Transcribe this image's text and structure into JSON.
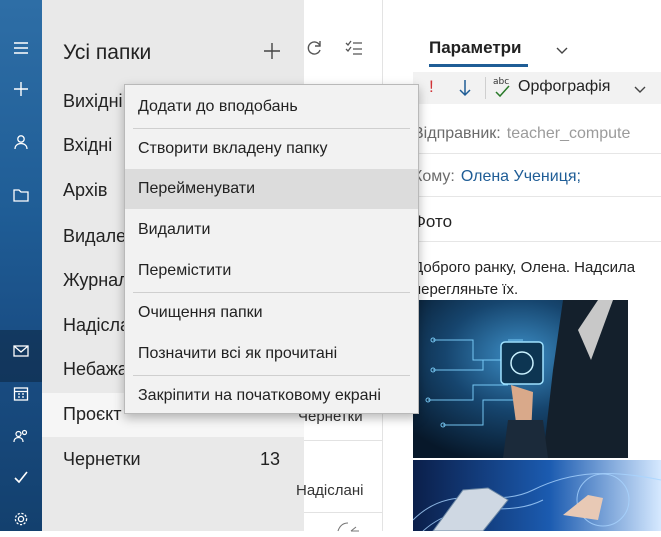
{
  "rail": {
    "icons": [
      "hamburger-icon",
      "plus-icon",
      "person-icon",
      "folder-icon",
      "mail-icon",
      "calendar-icon",
      "people-icon",
      "todo-icon",
      "gear-icon"
    ]
  },
  "folder_pane": {
    "title": "Усі папки",
    "folders": [
      {
        "label": "Вихідні",
        "count": ""
      },
      {
        "label": "Вхідні",
        "count": ""
      },
      {
        "label": "Архів",
        "count": ""
      },
      {
        "label": "Видале",
        "count": ""
      },
      {
        "label": "Журнал",
        "count": ""
      },
      {
        "label": "Надісла",
        "count": ""
      },
      {
        "label": "Небажа",
        "count": ""
      },
      {
        "label": "Проєкт",
        "count": ""
      },
      {
        "label": "Чернетки",
        "count": "13"
      }
    ]
  },
  "message_list": {
    "row_drafts": "Чернетки",
    "row_sent": "Надіслані"
  },
  "reading_pane": {
    "tab_label": "Параметри",
    "exclamation": "!",
    "spell_abc": "abc",
    "spelling_label": "Орфографія",
    "from_label": "Відправник:",
    "from_value": "teacher_compute",
    "to_label": "Кому:",
    "to_value": "Олена Учениця;",
    "subject": "Фото",
    "body_line1": "Доброго ранку, Олена. Надсила",
    "body_line2": "перегляньте їх."
  },
  "context_menu": {
    "items": [
      "Додати до вподобань",
      "Створити вкладену папку",
      "Перейменувати",
      "Видалити",
      "Перемістити",
      "Очищення папки",
      "Позначити всі як прочитані",
      "Закріпити на початковому екрані"
    ]
  },
  "colors": {
    "accent": "#1f5d96",
    "rail_top": "#2e6ea6",
    "rail_bottom": "#13406e",
    "folder_pane_bg": "#e9e9e9",
    "menu_bg": "#f2f2f2",
    "menu_highlight": "#dcdcdc",
    "high_importance": "#d13438"
  }
}
